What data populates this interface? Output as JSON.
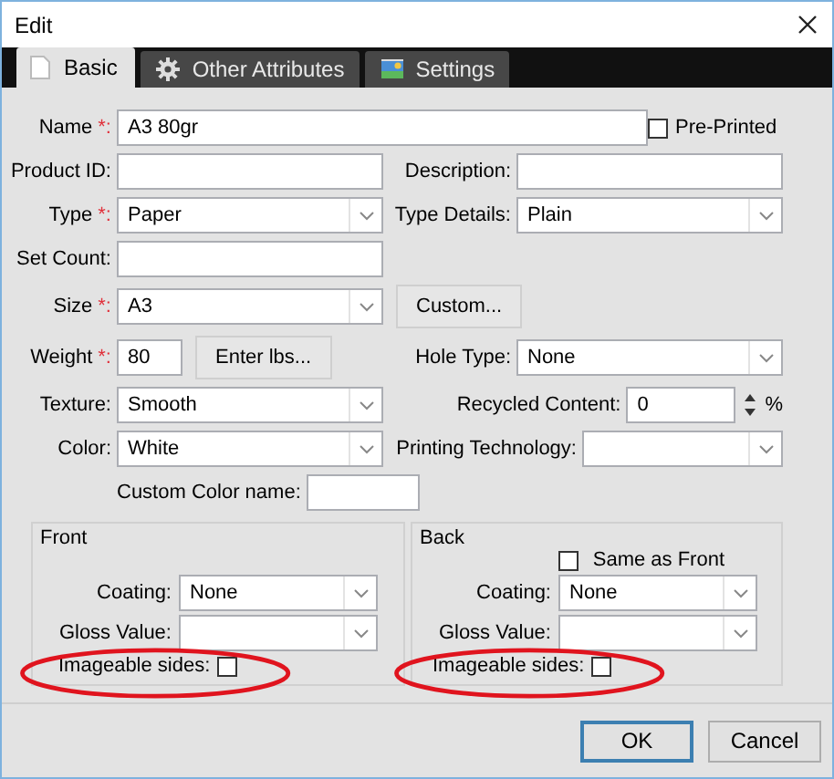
{
  "window": {
    "title": "Edit"
  },
  "tabs": [
    {
      "label": "Basic",
      "selected": true
    },
    {
      "label": "Other Attributes",
      "selected": false
    },
    {
      "label": "Settings",
      "selected": false
    }
  ],
  "rows": [
    {
      "left": {
        "kind": "wide_text",
        "label": "Name",
        "required_mark": "*:",
        "value": "A3 80gr"
      },
      "right": {
        "kind": "checkbox",
        "label": "Pre-Printed",
        "checked": false
      }
    },
    {
      "left": {
        "kind": "text",
        "label": "Product ID:"
      },
      "right": {
        "kind": "text",
        "label": "Description:"
      }
    },
    {
      "left": {
        "kind": "dropdown",
        "label": "Type",
        "required_mark": "*:",
        "value": "Paper"
      },
      "right": {
        "kind": "dropdown",
        "label": "Type Details:",
        "value": "Plain"
      }
    },
    {
      "left": {
        "kind": "text",
        "label": "Set Count:"
      }
    },
    {
      "left": {
        "kind": "dropdown_button",
        "label": "Size",
        "required_mark": "*:",
        "value": "A3",
        "button": "Custom..."
      }
    },
    {
      "left": {
        "kind": "text_button",
        "label": "Weight",
        "required_mark": "*:",
        "value": "80",
        "button": "Enter lbs..."
      },
      "right": {
        "kind": "dropdown",
        "label": "Hole Type:",
        "value": "None"
      }
    },
    {
      "left": {
        "kind": "dropdown",
        "label": "Texture:",
        "value": "Smooth"
      },
      "right": {
        "kind": "spinner",
        "label": "Recycled Content:",
        "value": "0",
        "unit": "%"
      }
    },
    {
      "left": {
        "kind": "dropdown",
        "label": "Color:",
        "value": "White"
      },
      "right": {
        "kind": "dropdown_narrow",
        "label": "Printing Technology:"
      }
    },
    {
      "left": {
        "kind": "inline_text",
        "label": "Custom Color name:"
      }
    }
  ],
  "groups": [
    {
      "title": "Front",
      "rows": [
        {
          "kind": "dropdown",
          "label": "Coating:",
          "value": "None"
        },
        {
          "kind": "dropdown",
          "label": "Gloss Value:"
        },
        {
          "kind": "labeled_checkbox",
          "label": "Imageable sides:",
          "checked": false,
          "circled": true
        }
      ]
    },
    {
      "title": "Back",
      "rows": [
        {
          "kind": "checkbox",
          "label": "Same as Front",
          "checked": false
        },
        {
          "kind": "dropdown",
          "label": "Coating:",
          "value": "None"
        },
        {
          "kind": "dropdown",
          "label": "Gloss Value:"
        },
        {
          "kind": "labeled_checkbox",
          "label": "Imageable sides:",
          "checked": false,
          "circled": true
        }
      ]
    }
  ],
  "buttons": [
    {
      "label": "OK",
      "default": true
    },
    {
      "label": "Cancel",
      "default": false
    }
  ]
}
